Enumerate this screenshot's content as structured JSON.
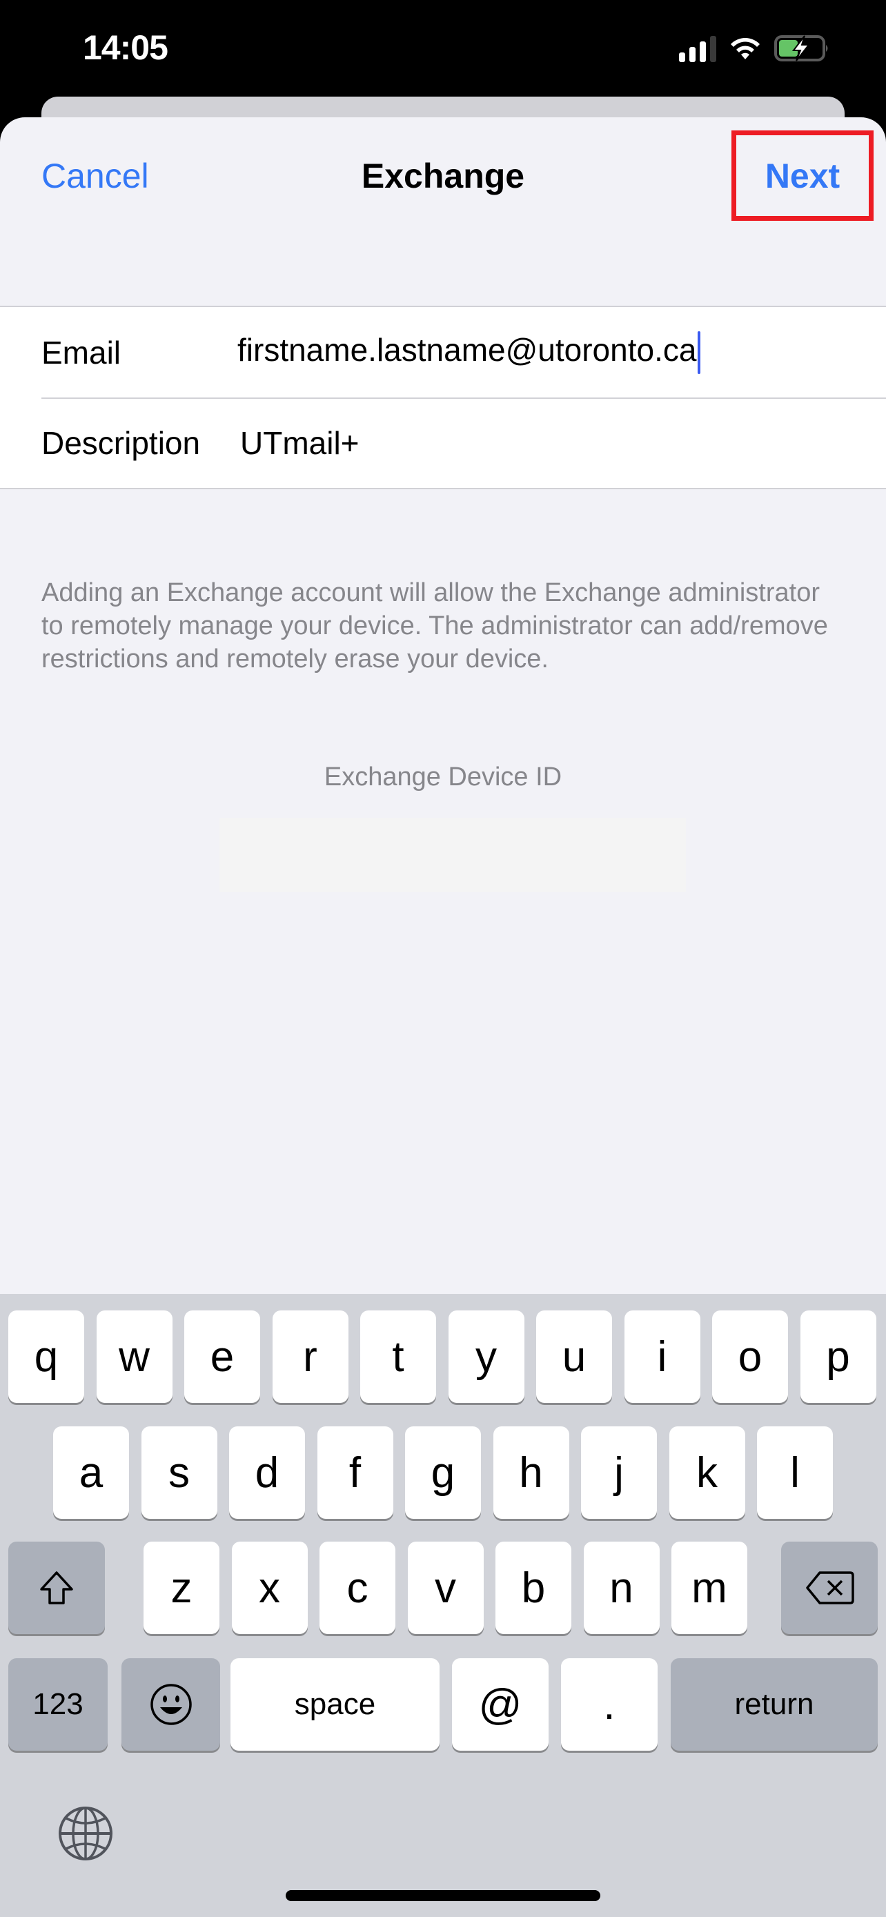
{
  "status_bar": {
    "time": "14:05",
    "signal_bars_active": 3,
    "signal_bars_total": 4,
    "wifi": "wifi-icon",
    "battery_level_fraction": 0.45,
    "battery_charging": true,
    "battery_color": "#65c466"
  },
  "nav": {
    "cancel_label": "Cancel",
    "title": "Exchange",
    "next_label": "Next",
    "accent_color": "#3478f6",
    "highlight_color": "#ed1c24"
  },
  "form": {
    "email": {
      "label": "Email",
      "value": "firstname.lastname@utoronto.ca"
    },
    "description": {
      "label": "Description",
      "value": "UTmail+"
    }
  },
  "footer_note": "Adding an Exchange account will allow the Exchange administrator to remotely manage your device. The administrator can add/remove restrictions and remotely erase your device.",
  "device_id": {
    "label": "Exchange Device ID"
  },
  "keyboard": {
    "row1": [
      "q",
      "w",
      "e",
      "r",
      "t",
      "y",
      "u",
      "i",
      "o",
      "p"
    ],
    "row2": [
      "a",
      "s",
      "d",
      "f",
      "g",
      "h",
      "j",
      "k",
      "l"
    ],
    "row3": [
      "z",
      "x",
      "c",
      "v",
      "b",
      "n",
      "m"
    ],
    "numbers_label": "123",
    "space_label": "space",
    "at_label": "@",
    "period_label": ".",
    "return_label": "return",
    "shift_icon": "shift-icon",
    "delete_icon": "delete-icon",
    "emoji_icon": "emoji-icon",
    "globe_icon": "globe-icon"
  }
}
